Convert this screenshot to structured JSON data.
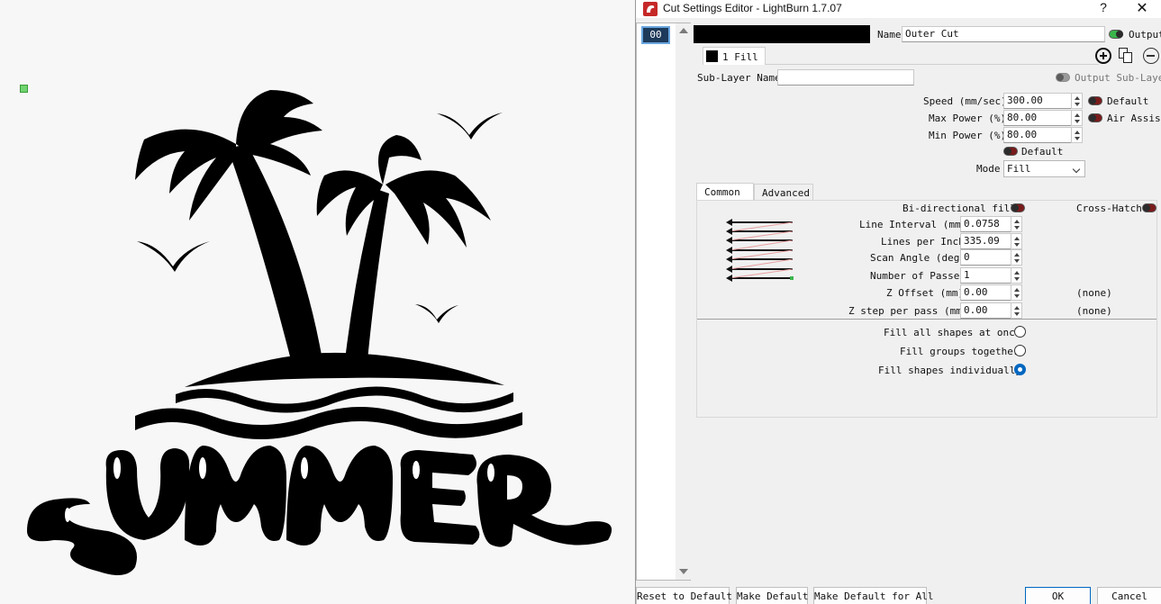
{
  "window": {
    "title": "Cut Settings Editor - LightBurn 1.7.07",
    "help_label": "?",
    "close_label": "✕"
  },
  "layer_list": {
    "items": [
      {
        "label": "00",
        "color": "#000000",
        "selected": true
      }
    ]
  },
  "layer": {
    "name_label": "Name",
    "name_value": "Outer Cut",
    "output_label": "Output",
    "output_on": true
  },
  "sublayer": {
    "tab_label": "1 Fill",
    "name_label": "Sub-Layer Name",
    "name_value": "",
    "output_label": "Output Sub-Layer"
  },
  "settings": {
    "speed_label": "Speed (mm/sec)",
    "speed_value": "300.00",
    "max_power_label": "Max Power (%)",
    "max_power_value": "80.00",
    "min_power_label": "Min Power (%)",
    "min_power_value": "80.00",
    "default_label": "Default",
    "air_assist_label": "Air Assist",
    "default2_label": "Default",
    "mode_label": "Mode",
    "mode_value": "Fill"
  },
  "tabs": [
    {
      "label": "Common",
      "active": true
    },
    {
      "label": "Advanced",
      "active": false
    }
  ],
  "common": {
    "bidirectional_label": "Bi-directional fill",
    "crosshatch_label": "Cross-Hatch",
    "line_interval_label": "Line Interval (mm)",
    "line_interval_value": "0.0758",
    "lines_per_inch_label": "Lines per Inch",
    "lines_per_inch_value": "335.09",
    "scan_angle_label": "Scan Angle (deg)",
    "scan_angle_value": "0",
    "passes_label": "Number of Passes",
    "passes_value": "1",
    "z_offset_label": "Z Offset (mm)",
    "z_offset_value": "0.00",
    "z_offset_note": "(none)",
    "z_step_label": "Z step per pass (mm)",
    "z_step_value": "0.00",
    "z_step_note": "(none)"
  },
  "fill_options": [
    {
      "label": "Fill all shapes at once",
      "checked": false
    },
    {
      "label": "Fill groups together",
      "checked": false
    },
    {
      "label": "Fill shapes individually",
      "checked": true
    }
  ],
  "footer": {
    "reset_label": "Reset to Default",
    "make_default_label": "Make Default",
    "make_default_all_label": "Make Default for All",
    "ok_label": "OK",
    "cancel_label": "Cancel"
  },
  "canvas": {
    "artwork_text": "SUMMER"
  }
}
